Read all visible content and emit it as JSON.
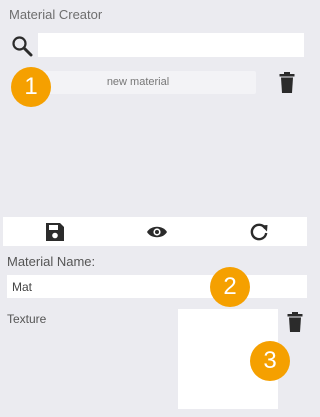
{
  "panel": {
    "title": "Material Creator"
  },
  "search": {
    "icon": "search-icon",
    "value": "",
    "placeholder": ""
  },
  "materials": {
    "items": [
      {
        "label": "new material",
        "delete_icon": "trash-icon"
      }
    ]
  },
  "toolbar": {
    "buttons": [
      {
        "icon": "save-icon"
      },
      {
        "icon": "eye-icon"
      },
      {
        "icon": "refresh-icon"
      }
    ]
  },
  "form": {
    "name_label": "Material Name:",
    "name_value": "Mat",
    "texture_label": "Texture",
    "texture_delete_icon": "trash-icon"
  },
  "callouts": [
    "1",
    "2",
    "3"
  ],
  "colors": {
    "background": "#ebebf0",
    "callout": "#f5a000",
    "icon": "#2b2b2b"
  }
}
